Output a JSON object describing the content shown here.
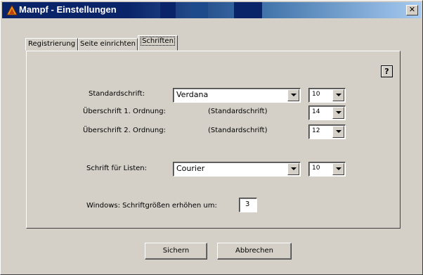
{
  "window": {
    "title": "Mampf - Einstellungen",
    "close_glyph": "✕"
  },
  "tabs": [
    {
      "label": "Registrierung",
      "active": false
    },
    {
      "label": "Seite einrichten",
      "active": false
    },
    {
      "label": "Schriften",
      "active": true
    }
  ],
  "help": {
    "label": "?"
  },
  "fonts": {
    "standard": {
      "label": "Standardschrift:",
      "font": "Verdana",
      "size": "10"
    },
    "heading1": {
      "label": "Überschrift 1. Ordnung:",
      "font": "(Standardschrift)",
      "size": "14"
    },
    "heading2": {
      "label": "Überschrift 2. Ordnung:",
      "font": "(Standardschrift)",
      "size": "12"
    },
    "lists": {
      "label": "Schrift für Listen:",
      "font": "Courier",
      "size": "10"
    }
  },
  "windows_increase": {
    "label": "Windows: Schriftgrößen erhöhen um:",
    "value": "3"
  },
  "buttons": {
    "save": "Sichern",
    "cancel": "Abbrechen"
  },
  "colors": {
    "face": "#d4d0c8",
    "title_active": "#0a246a"
  },
  "icons": {
    "app": "mampf-app-icon",
    "dropdown": "chevron-down-icon"
  }
}
